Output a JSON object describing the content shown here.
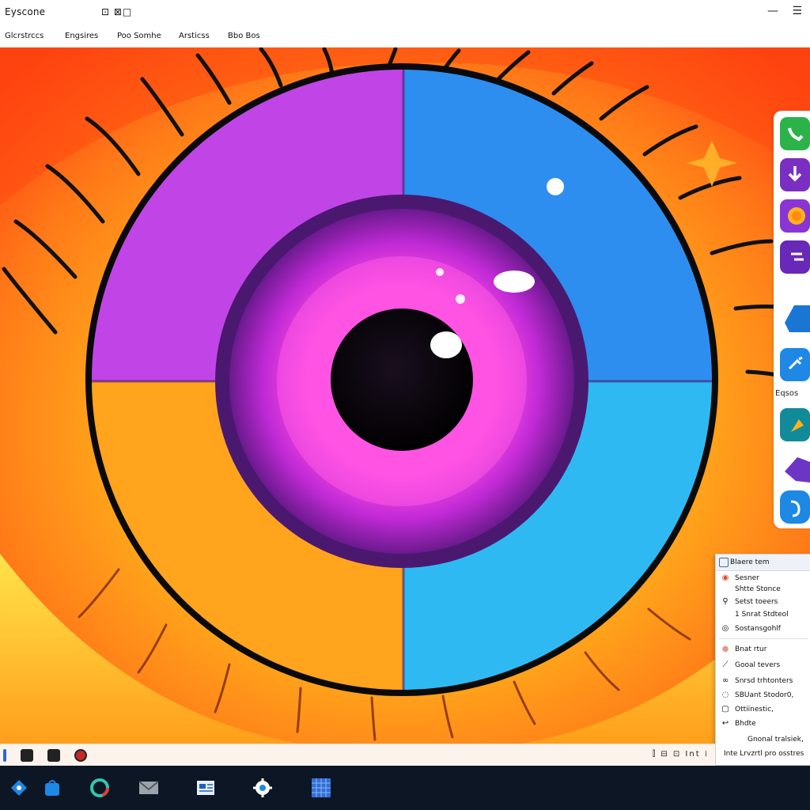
{
  "window": {
    "title": "Eyscone",
    "title_glyphs": "⊡ ⊠□"
  },
  "menu": {
    "items": [
      "Glcrstrccs",
      "Engsires",
      "Poo Somhe",
      "Arsticss",
      "Bbo Bos"
    ]
  },
  "dock": {
    "caption": "Eqsos",
    "tiles": [
      {
        "name": "phone-app-icon",
        "color": "#2bb34a"
      },
      {
        "name": "download-app-icon",
        "color": "#7b2fc2"
      },
      {
        "name": "coin-app-icon",
        "color": "#8a34d6"
      },
      {
        "name": "list-app-icon",
        "color": "#6a28b8"
      },
      {
        "name": "shape-app-icon",
        "color": "#1976d2"
      },
      {
        "name": "tool-app-icon",
        "color": "#1f88e5"
      },
      {
        "name": "teal-app-icon",
        "color": "#118a9a"
      },
      {
        "name": "star-app-icon",
        "color": "#6d35c6"
      },
      {
        "name": "audio-app-icon",
        "color": "#1e88e5"
      }
    ]
  },
  "context_menu": {
    "header": "Blaere tem",
    "items": [
      "Sesner",
      "Shtte Stonce",
      "Setst toeers",
      "1 Snrat Stdteol",
      "Sostansgohlf",
      "Bnat rtur",
      "Gooal tevers",
      "Snrsd trhtonters",
      "SBUant Stodor0,",
      "Ottiinestic,",
      "Bhdte",
      "Gnonal tralsiek,",
      "Inte Lrvzrtl pro osstres"
    ]
  },
  "statusbar": {
    "right_text": "⫿ ⊟ ⊡ Int ⁞"
  },
  "colors": {
    "sky_orange": "#ff6a1a",
    "iris_purple": "#b43ce6",
    "iris_blue": "#2aa9f0",
    "iris_yellow": "#ffb21c",
    "pupil": "#000000",
    "taskbar": "#0d1624"
  }
}
